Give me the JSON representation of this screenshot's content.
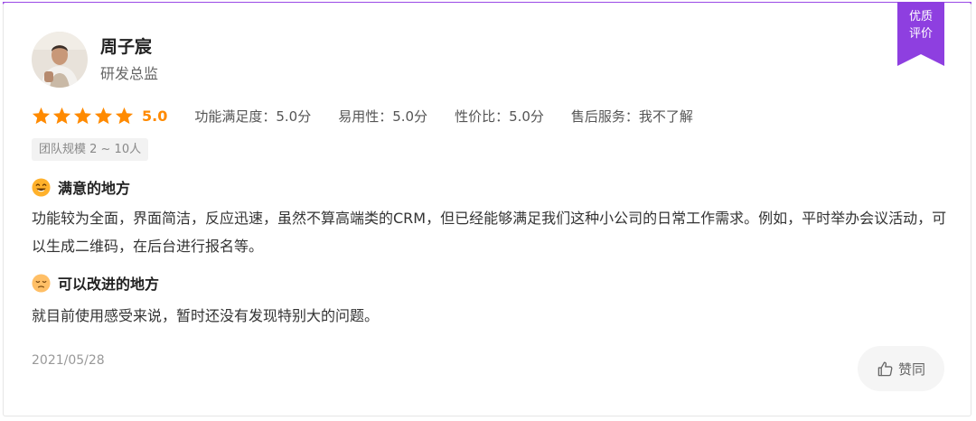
{
  "badge": {
    "line1": "优质",
    "line2": "评价",
    "color": "#8e3fe0"
  },
  "reviewer": {
    "name": "周子宸",
    "title": "研发总监"
  },
  "rating": {
    "stars": 5,
    "max_stars": 5,
    "score": "5.0",
    "metrics": [
      "功能满足度：5.0分",
      "易用性：5.0分",
      "性价比：5.0分",
      "售后服务：我不了解"
    ]
  },
  "team_size_tag": "团队规模 2 ~ 10人",
  "pros": {
    "icon": "smile-emoji-icon",
    "title": "满意的地方",
    "text": "功能较为全面，界面简洁，反应迅速，虽然不算高端类的CRM，但已经能够满足我们这种小公司的日常工作需求。例如，平时举办会议活动，可以生成二维码，在后台进行报名等。"
  },
  "cons": {
    "icon": "pensive-emoji-icon",
    "title": "可以改进的地方",
    "text": "就目前使用感受来说，暂时还没有发现特别大的问题。"
  },
  "date": "2021/05/28",
  "like_button": {
    "icon": "thumbs-up-icon",
    "label": "赞同"
  },
  "colors": {
    "accent_purple": "#9a49e6",
    "star_orange": "#ff8a00"
  }
}
